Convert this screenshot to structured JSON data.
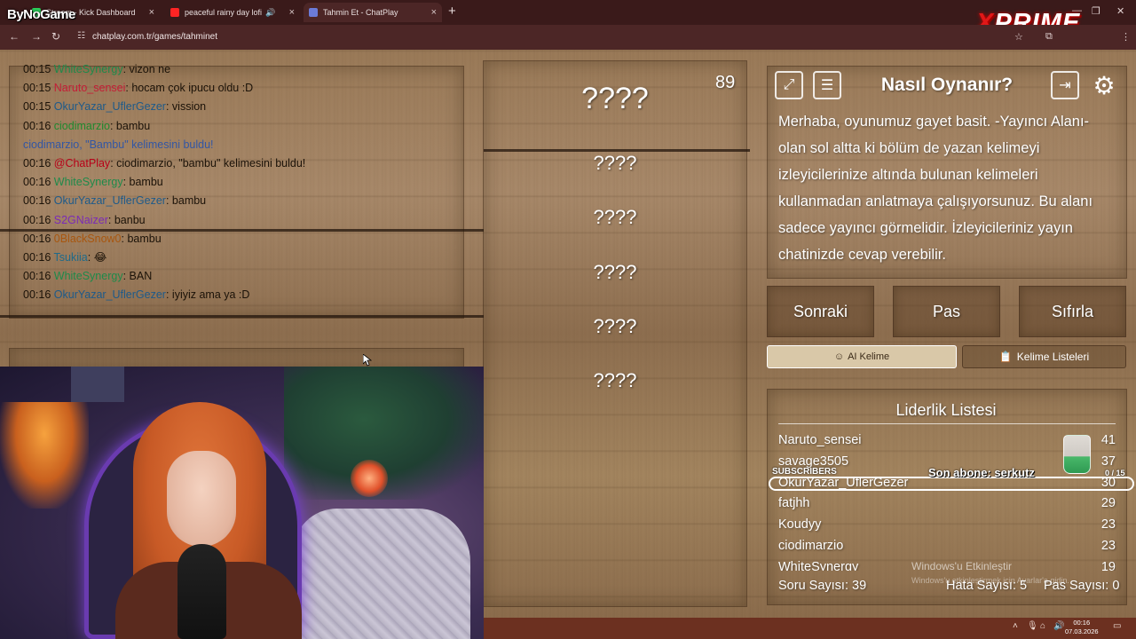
{
  "brand": "ByNoGame",
  "prime_logo": {
    "x": "X",
    "rest": "PRIME"
  },
  "tabs": [
    {
      "label": "Stream - Kick Dashboard",
      "color": "#2bd15b"
    },
    {
      "label": "peaceful rainy day lofi",
      "color": "#ff2424"
    },
    {
      "label": "Tahmin Et - ChatPlay",
      "color": "#6b7bd8"
    }
  ],
  "url": "chatplay.com.tr/games/tahminet",
  "chat": [
    {
      "time": "00:15",
      "user": "WhiteSynergy",
      "color": "#1e8a4a",
      "text": ": vizon ne"
    },
    {
      "time": "00:15",
      "user": "Naruto_sensei",
      "color": "#c41d36",
      "text": ": hocam çok ipucu oldu :D"
    },
    {
      "time": "00:15",
      "user": "OkurYazar_UflerGezer",
      "color": "#1d5a8a",
      "text": ": vission"
    },
    {
      "time": "00:16",
      "user": "ciodimarzio",
      "color": "#1e8a2e",
      "text": ": bambu"
    },
    {
      "system": "ciodimarzio, \"Bambu\" kelimesini buldu!"
    },
    {
      "time": "00:16",
      "user": "@ChatPlay",
      "color": "#b80018",
      "text": ": ciodimarzio, \"bambu\" kelimesini buldu!"
    },
    {
      "time": "00:16",
      "user": "WhiteSynergy",
      "color": "#1e8a4a",
      "text": ": bambu"
    },
    {
      "time": "00:16",
      "user": "OkurYazar_UflerGezer",
      "color": "#1d5a8a",
      "text": ": bambu"
    },
    {
      "time": "00:16",
      "user": "S2GNaizer",
      "color": "#7a2ab8",
      "text": ": banbu"
    },
    {
      "time": "00:16",
      "user": "0BlackSnow0",
      "color": "#a8560e",
      "text": ": bambu"
    },
    {
      "time": "00:16",
      "user": "Tsukiia",
      "color": "#1e6a8a",
      "text": ": 😂"
    },
    {
      "time": "00:16",
      "user": "WhiteSynergy",
      "color": "#1e8a4a",
      "text": ": BAN"
    },
    {
      "time": "00:16",
      "user": "OkurYazar_UflerGezer",
      "color": "#1d5a8a",
      "text": ": iyiyiz ama ya :D"
    }
  ],
  "timer": "89",
  "words": [
    "????",
    "????",
    "????",
    "????",
    "????",
    "????"
  ],
  "howto": {
    "title": "Nasıl Oynanır?",
    "text": "Merhaba, oyunumuz gayet basit. -Yayıncı Alanı- olan sol altta ki bölüm de yazan kelimeyi izleyicilerinize altında bulunan kelimeleri kullanmadan anlatmaya çalışıyorsunuz. Bu alanı sadece yayıncı görmelidir. İzleyicileriniz yayın chatinizde cevap verebilir."
  },
  "buttons": {
    "next": "Sonraki",
    "pass": "Pas",
    "reset": "Sıfırla"
  },
  "small_buttons": {
    "ai": "AI Kelime",
    "lists": "Kelime Listeleri"
  },
  "leaderboard": {
    "title": "Liderlik Listesi",
    "rows": [
      {
        "name": "Naruto_sensei",
        "score": "41"
      },
      {
        "name": "savage3505",
        "score": "37"
      },
      {
        "name": "OkurYazar_UflerGezer",
        "score": "30"
      },
      {
        "name": "fatjhh",
        "score": "29"
      },
      {
        "name": "Koudyy",
        "score": "23"
      },
      {
        "name": "ciodimarzio",
        "score": "23"
      },
      {
        "name": "WhiteSynergy",
        "score": "19"
      }
    ]
  },
  "stats": {
    "questions": "Soru Sayısı: 39",
    "errors": "Hata Sayısı: 5",
    "passes": "Pas Sayısı: 0"
  },
  "overlay": {
    "subscribers_label": "SUBSCRIBERS",
    "last_sub": "Son abone: serkutz",
    "sub_count": "0 / 15",
    "activate_line1": "Windows'u Etkinleştir",
    "activate_line2": "Windows'u etkinleştirmek için Ayarlar'a gidin."
  },
  "clock": {
    "time": "00:16",
    "date": "07.03.2026"
  },
  "colors": {
    "accent_red": "#e01818",
    "browser_bg": "#3a1a1a"
  }
}
